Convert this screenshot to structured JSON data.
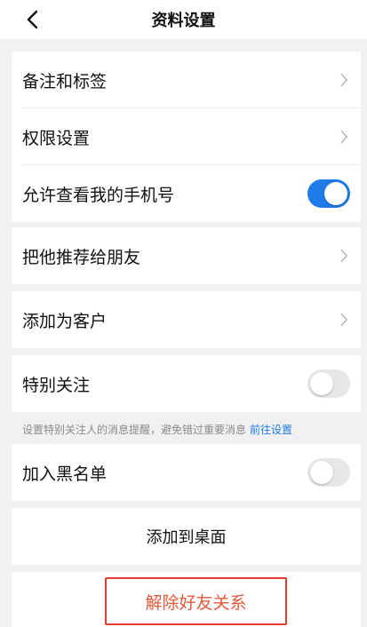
{
  "header": {
    "title": "资料设置"
  },
  "items": {
    "remark": "备注和标签",
    "permission": "权限设置",
    "allow_phone": {
      "label": "允许查看我的手机号",
      "on": true
    },
    "recommend": "把他推荐给朋友",
    "add_customer": "添加为客户",
    "special": {
      "label": "特别关注",
      "on": false
    },
    "hint": {
      "text": "设置特别关注人的消息提醒，避免错过重要消息",
      "link": "前往设置"
    },
    "blacklist": {
      "label": "加入黑名单",
      "on": false
    },
    "add_desktop": "添加到桌面",
    "delete_friend": "解除好友关系"
  },
  "colors": {
    "accent": "#1e7be8",
    "danger": "#e2593b"
  },
  "icons": [
    "back-icon",
    "chevron-right-icon"
  ]
}
